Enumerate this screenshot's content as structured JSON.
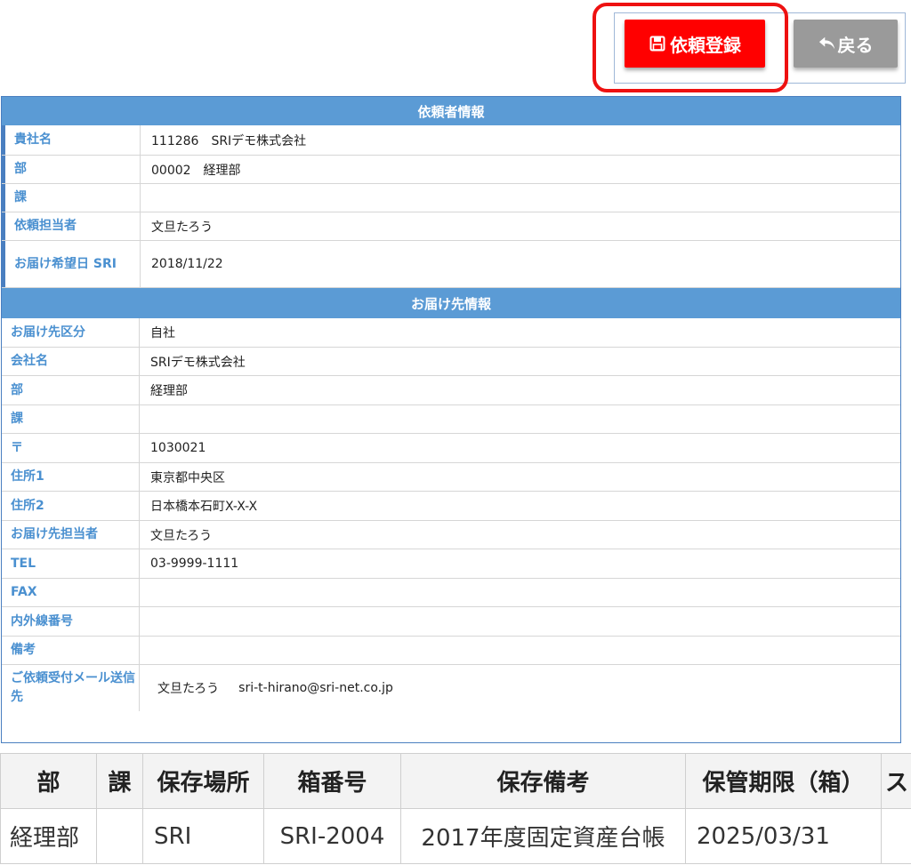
{
  "toolbar": {
    "register_label": "依頼登録",
    "back_label": "戻る",
    "register_icon": "save-icon",
    "back_icon": "undo-arrow-icon"
  },
  "requester": {
    "title": "依頼者情報",
    "rows": [
      {
        "label": "貴社名",
        "value": "111286　SRIデモ株式会社"
      },
      {
        "label": "部",
        "value": "00002　経理部"
      },
      {
        "label": "課",
        "value": ""
      },
      {
        "label": "依頼担当者",
        "value": "文旦たろう"
      },
      {
        "label": "お届け希望日 SRI",
        "value": "2018/11/22"
      }
    ]
  },
  "delivery": {
    "title": "お届け先情報",
    "rows": [
      {
        "label": "お届け先区分",
        "value": "自社"
      },
      {
        "label": "会社名",
        "value": "SRIデモ株式会社"
      },
      {
        "label": "部",
        "value": "経理部"
      },
      {
        "label": "課",
        "value": ""
      },
      {
        "label": "〒",
        "value": "1030021"
      },
      {
        "label": "住所1",
        "value": "東京都中央区"
      },
      {
        "label": "住所2",
        "value": "日本橋本石町X-X-X"
      },
      {
        "label": "お届け先担当者",
        "value": "文旦たろう"
      },
      {
        "label": "TEL",
        "value": "03-9999-1111"
      },
      {
        "label": "FAX",
        "value": ""
      },
      {
        "label": "内外線番号",
        "value": ""
      },
      {
        "label": "備考",
        "value": ""
      }
    ],
    "mail_label": "ご依頼受付メール送信先",
    "mail_name": "文旦たろう",
    "mail_address": "sri-t-hirano@sri-net.co.jp"
  },
  "box_table": {
    "headers": [
      "部",
      "課",
      "保存場所",
      "箱番号",
      "保存備考",
      "保管期限（箱）",
      "ス"
    ],
    "rows": [
      [
        "経理部",
        "",
        "SRI",
        "SRI-2004",
        "2017年度固定資産台帳",
        "2025/03/31",
        ""
      ]
    ]
  },
  "colors": {
    "header_blue": "#5b9bd5",
    "label_blue": "#4a90d0",
    "register_red": "#ff0000",
    "back_gray": "#9a9a9a"
  }
}
